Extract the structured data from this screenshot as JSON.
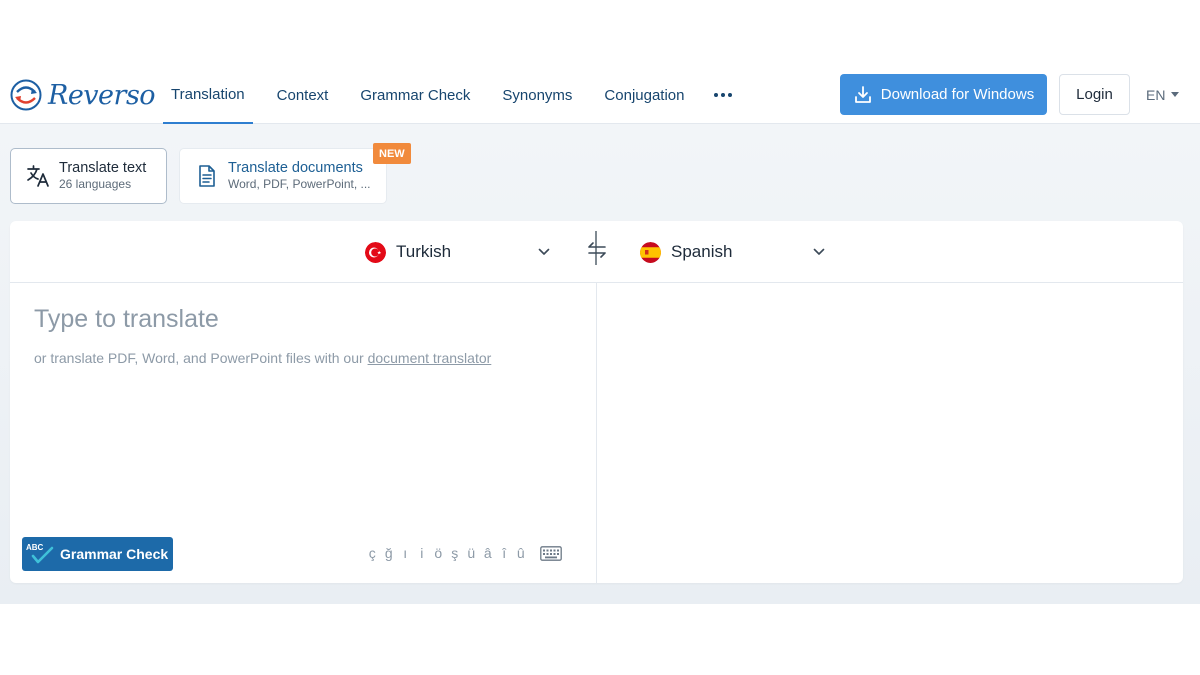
{
  "brand": {
    "name": "Reverso"
  },
  "nav": {
    "items": [
      {
        "label": "Translation",
        "active": true
      },
      {
        "label": "Context"
      },
      {
        "label": "Grammar Check"
      },
      {
        "label": "Synonyms"
      },
      {
        "label": "Conjugation"
      }
    ],
    "more_icon": "more-dots-icon"
  },
  "header": {
    "download_label": "Download for Windows",
    "login_label": "Login",
    "ui_language": "EN"
  },
  "modes": {
    "text": {
      "title": "Translate text",
      "subtitle": "26 languages"
    },
    "documents": {
      "title": "Translate documents",
      "subtitle": "Word, PDF, PowerPoint, ...",
      "badge": "NEW"
    }
  },
  "translator": {
    "source_language": "Turkish",
    "target_language": "Spanish",
    "placeholder": "Type to translate",
    "helper_text": "or translate PDF, Word, and PowerPoint files with our",
    "helper_link": "document translator",
    "grammar_check_label": "Grammar Check",
    "grammar_icon_text": "ABC",
    "special_chars": [
      "ç",
      "ğ",
      "ı",
      "i",
      "ö",
      "ş",
      "ü",
      "â",
      "î",
      "û"
    ]
  },
  "colors": {
    "brand_blue": "#1d5fa3",
    "primary_button": "#3f8fdd",
    "grammar_button": "#1d6aa9",
    "new_badge": "#f18a3c"
  }
}
